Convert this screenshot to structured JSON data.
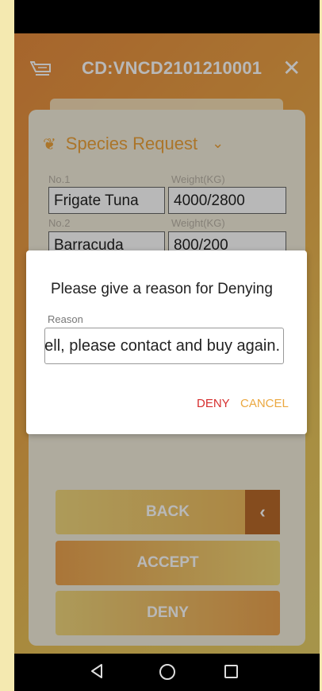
{
  "header": {
    "title": "CD:VNCD2101210001",
    "icon": "cart-icon",
    "close_icon": "close-icon"
  },
  "species": {
    "header_label": "Species Request",
    "rows": [
      {
        "no_label": "No.1",
        "weight_label": "Weight(KG)",
        "name": "Frigate Tuna",
        "weight": "4000/2800"
      },
      {
        "no_label": "No.2",
        "weight_label": "Weight(KG)",
        "name": "Barracuda",
        "weight": "800/200"
      }
    ]
  },
  "buttons": {
    "back": "BACK",
    "accept": "ACCEPT",
    "deny": "DENY"
  },
  "dialog": {
    "title": "Please give a reason for Denying",
    "reason_label": "Reason",
    "reason_value": "ell, please contact and buy again.",
    "deny_label": "DENY",
    "cancel_label": "CANCEL"
  },
  "colors": {
    "accent": "#EDA23B",
    "deny": "#D62E2E",
    "cancel": "#EBA840"
  }
}
